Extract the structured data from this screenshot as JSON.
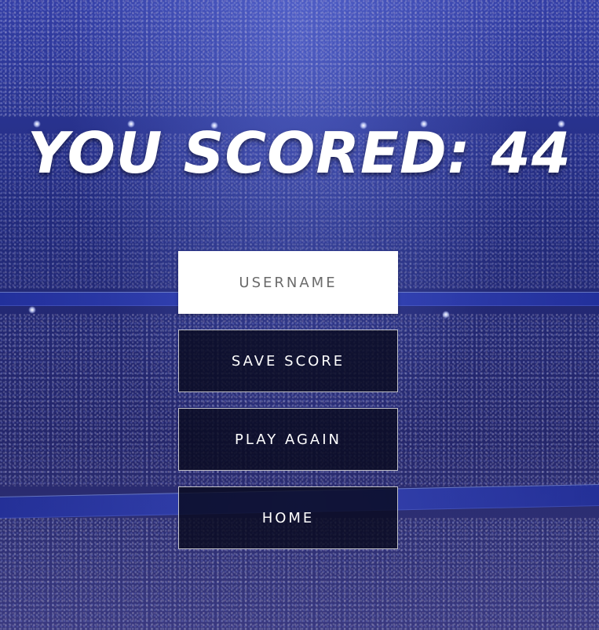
{
  "result": {
    "title": "YOU SCORED: 44"
  },
  "form": {
    "username_placeholder": "USERNAME",
    "username_value": ""
  },
  "buttons": {
    "save_label": "SAVE SCORE",
    "play_again_label": "PLAY AGAIN",
    "home_label": "HOME"
  },
  "background": {
    "scene": "stadium-crowd-image",
    "accent": "#2f3aa0"
  }
}
